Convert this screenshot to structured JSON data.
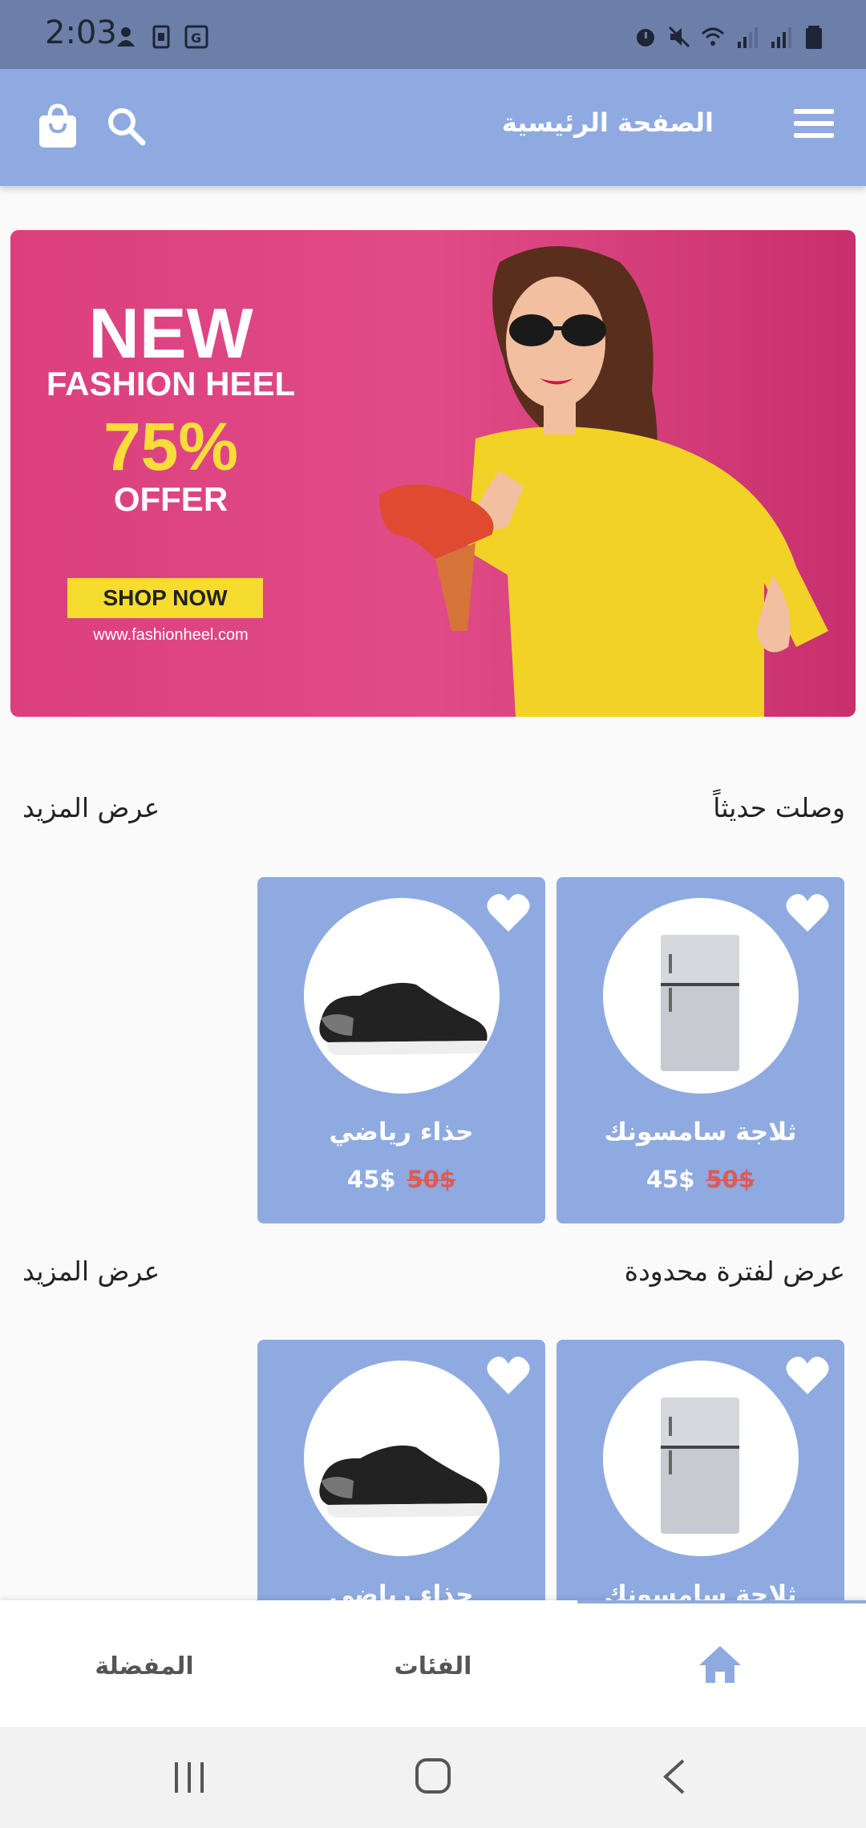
{
  "status_bar": {
    "time": "2:03"
  },
  "app_bar": {
    "title": "الصفحة الرئيسية"
  },
  "banner": {
    "line1": "NEW",
    "line2": "FASHION HEEL",
    "line3": "75%",
    "line4": "OFFER",
    "button": "SHOP NOW",
    "url": "www.fashionheel.com"
  },
  "sections": [
    {
      "title": "وصلت حديثاً",
      "more": "عرض المزيد",
      "products": [
        {
          "name": "ثلاجة سامسونك",
          "price": "45$",
          "old_price": "50$",
          "image": "fridge"
        },
        {
          "name": "حذاء رياضي",
          "price": "45$",
          "old_price": "50$",
          "image": "sneaker"
        }
      ]
    },
    {
      "title": "عرض لفترة محدودة",
      "more": "عرض المزيد",
      "products": [
        {
          "name": "ثلاجة سامسونك",
          "image": "fridge"
        },
        {
          "name": "حذاء رياضي",
          "image": "sneaker"
        }
      ]
    }
  ],
  "bottom_nav": {
    "home": "home-icon",
    "categories": "الفئات",
    "favorites": "المفضلة"
  },
  "colors": {
    "primary": "#8eaae0",
    "status_bar": "#6b7fa8",
    "old_price": "#e05a55"
  }
}
